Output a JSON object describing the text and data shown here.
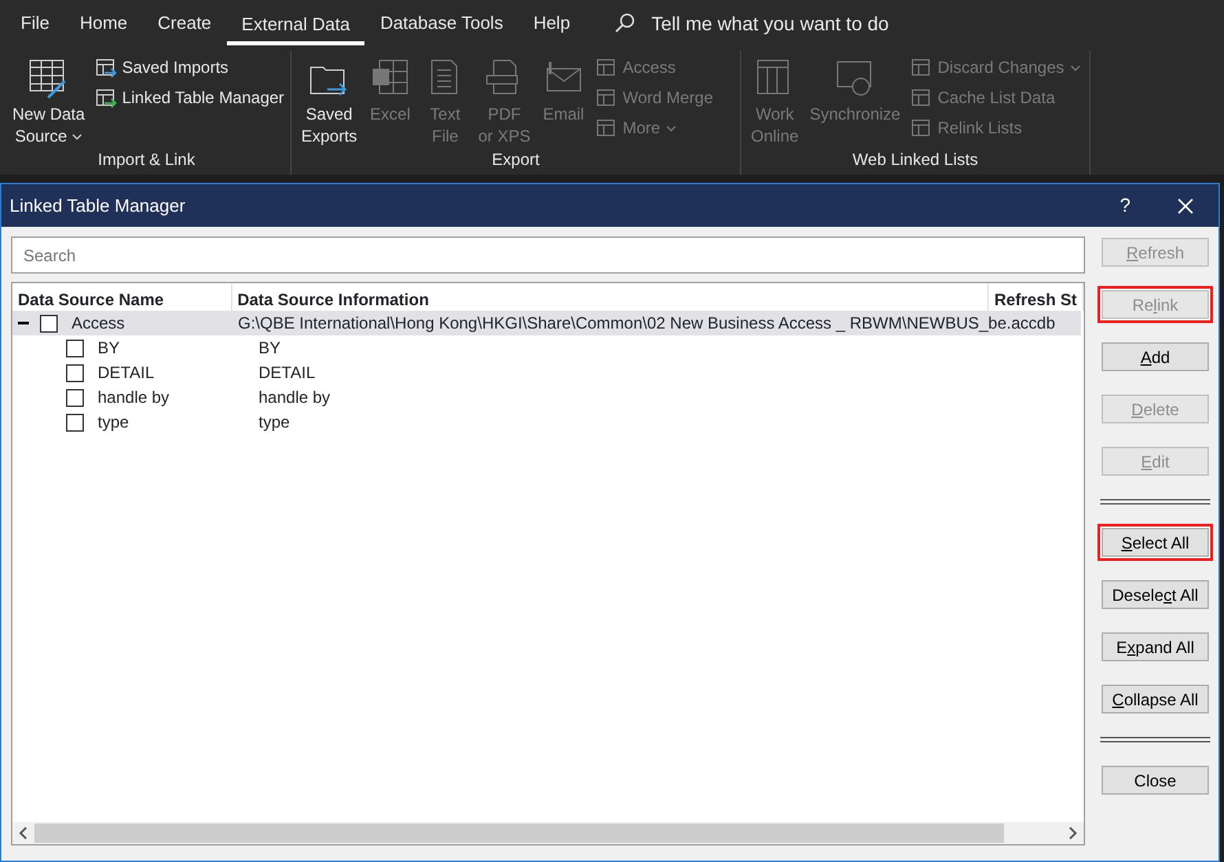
{
  "ribbon": {
    "tabs": [
      {
        "label": "File",
        "selected": false
      },
      {
        "label": "Home",
        "selected": false
      },
      {
        "label": "Create",
        "selected": false
      },
      {
        "label": "External Data",
        "selected": true
      },
      {
        "label": "Database Tools",
        "selected": false
      },
      {
        "label": "Help",
        "selected": false
      }
    ],
    "tell_me": {
      "placeholder": "Tell me what you want to do"
    },
    "groups": [
      {
        "title": "Import & Link",
        "large": [
          {
            "lines": [
              "New Data",
              "Source"
            ],
            "disabled": false,
            "dropdown": true
          }
        ],
        "small": [
          {
            "label": "Saved Imports",
            "disabled": false,
            "dropdown": false
          },
          {
            "label": "Linked Table Manager",
            "disabled": false,
            "dropdown": false
          }
        ]
      },
      {
        "title": "Export",
        "large": [
          {
            "lines": [
              "Saved",
              "Exports"
            ],
            "disabled": false,
            "dropdown": false
          },
          {
            "lines": [
              "Excel"
            ],
            "disabled": true,
            "dropdown": false
          },
          {
            "lines": [
              "Text",
              "File"
            ],
            "disabled": true,
            "dropdown": false
          },
          {
            "lines": [
              "PDF",
              "or XPS"
            ],
            "disabled": true,
            "dropdown": false
          },
          {
            "lines": [
              "Email"
            ],
            "disabled": true,
            "dropdown": false
          }
        ],
        "small": [
          {
            "label": "Access",
            "disabled": true,
            "dropdown": false
          },
          {
            "label": "Word Merge",
            "disabled": true,
            "dropdown": false
          },
          {
            "label": "More",
            "disabled": true,
            "dropdown": true
          }
        ]
      },
      {
        "title": "Web Linked Lists",
        "large": [
          {
            "lines": [
              "Work",
              "Online"
            ],
            "disabled": true,
            "dropdown": false
          },
          {
            "lines": [
              "Synchronize"
            ],
            "disabled": true,
            "dropdown": false
          }
        ],
        "small": [
          {
            "label": "Discard Changes",
            "disabled": true,
            "dropdown": true
          },
          {
            "label": "Cache List Data",
            "disabled": true,
            "dropdown": false
          },
          {
            "label": "Relink Lists",
            "disabled": true,
            "dropdown": false
          }
        ]
      }
    ]
  },
  "dialog": {
    "title": "Linked Table Manager",
    "help": "?",
    "search": {
      "placeholder": "Search"
    },
    "table": {
      "columns": [
        "Data Source Name",
        "Data Source Information",
        "Refresh St"
      ],
      "rows": [
        {
          "name": "Access",
          "info": "G:\\QBE International\\Hong Kong\\HKGI\\Share\\Common\\02 New Business Access _ RBWM\\NEWBUS_be.accdb",
          "checked": false,
          "expanded": true,
          "selected": true,
          "children": [
            {
              "name": "BY",
              "info": "BY",
              "checked": false
            },
            {
              "name": "DETAIL",
              "info": "DETAIL",
              "checked": false
            },
            {
              "name": "handle by",
              "info": "handle by",
              "checked": false
            },
            {
              "name": "type",
              "info": "type",
              "checked": false
            }
          ]
        }
      ]
    },
    "buttons": [
      {
        "kind": "button",
        "key": "R",
        "after": "efresh",
        "disabled": true,
        "highlighted": false
      },
      {
        "kind": "button",
        "before": "Re",
        "key": "l",
        "after": "ink",
        "disabled": true,
        "highlighted": true
      },
      {
        "kind": "button",
        "key": "A",
        "after": "dd",
        "disabled": false,
        "highlighted": false
      },
      {
        "kind": "button",
        "key": "D",
        "after": "elete",
        "disabled": true,
        "highlighted": false
      },
      {
        "kind": "button",
        "key": "E",
        "after": "dit",
        "disabled": true,
        "highlighted": false
      },
      {
        "kind": "separator"
      },
      {
        "kind": "button",
        "key": "S",
        "after": "elect All",
        "disabled": false,
        "highlighted": true
      },
      {
        "kind": "button",
        "before": "Desele",
        "key": "c",
        "after": "t All",
        "disabled": false,
        "highlighted": false
      },
      {
        "kind": "button",
        "before": "E",
        "key": "x",
        "after": "pand All",
        "disabled": false,
        "highlighted": false
      },
      {
        "kind": "button",
        "key": "C",
        "after": "ollapse All",
        "disabled": false,
        "highlighted": false
      },
      {
        "kind": "separator"
      },
      {
        "kind": "button",
        "before": "Close",
        "disabled": false,
        "highlighted": false
      }
    ]
  }
}
